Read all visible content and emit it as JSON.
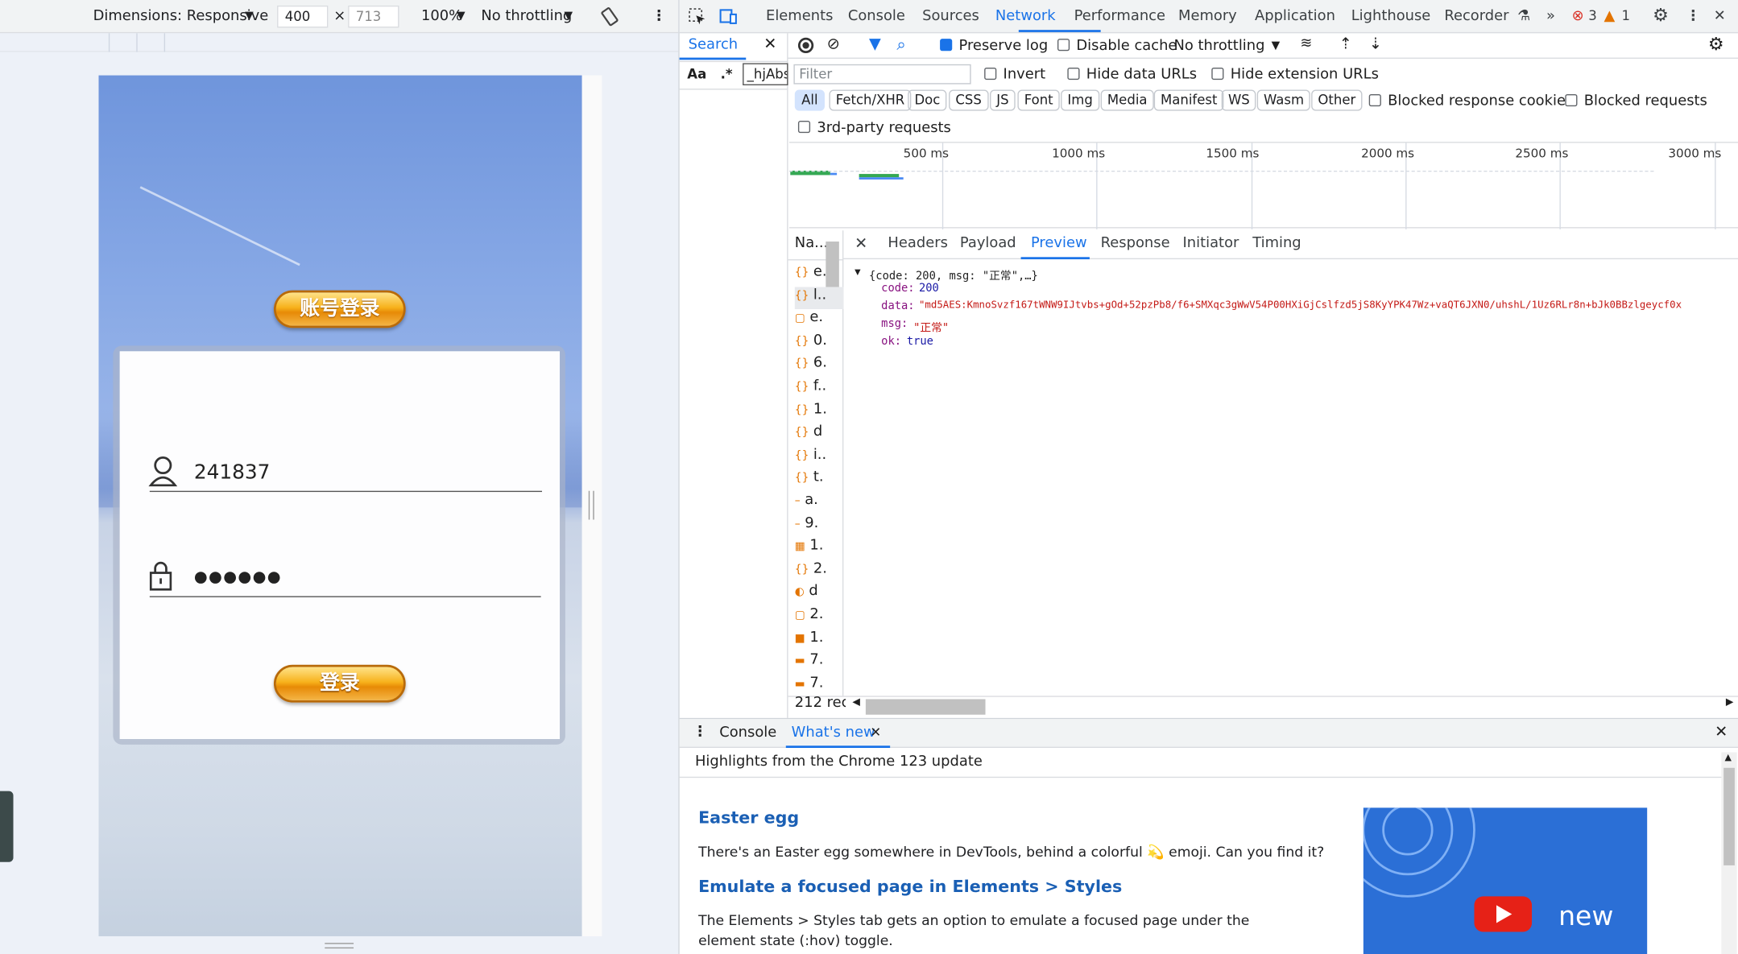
{
  "device_toolbar": {
    "dimensions_label": "Dimensions: Responsive",
    "width": "400",
    "height": "713",
    "zoom": "100%",
    "throttling": "No throttling"
  },
  "login": {
    "tab_title": "账号登录",
    "username": "241837",
    "password_mask": "●●●●●●",
    "login_button": "登录"
  },
  "devtools": {
    "tabs": [
      "Elements",
      "Console",
      "Sources",
      "Network",
      "Performance",
      "Memory",
      "Application",
      "Lighthouse",
      "Recorder"
    ],
    "more": "»",
    "error_count": "3",
    "warning_count": "1",
    "search": {
      "title": "Search",
      "case_label": "Aa",
      "regex_label": ".*",
      "query": "_hjAbs"
    },
    "network": {
      "preserve_log": "Preserve log",
      "disable_cache": "Disable cache",
      "throttling": "No throttling",
      "filter_placeholder": "Filter",
      "invert": "Invert",
      "hide_data_urls": "Hide data URLs",
      "hide_extension_urls": "Hide extension URLs",
      "types": [
        "All",
        "Fetch/XHR",
        "Doc",
        "CSS",
        "JS",
        "Font",
        "Img",
        "Media",
        "Manifest",
        "WS",
        "Wasm",
        "Other"
      ],
      "blocked_cookies": "Blocked response cookies",
      "blocked_requests": "Blocked requests",
      "third_party": "3rd-party requests",
      "timeline_ticks": [
        "500 ms",
        "1000 ms",
        "1500 ms",
        "2000 ms",
        "2500 ms",
        "3000 ms"
      ],
      "name_header": "Na...",
      "names": [
        "e.",
        "l..",
        "e.",
        "0.",
        "6.",
        "f..",
        "1.",
        "d",
        "i..",
        "t.",
        "a.",
        "9.",
        "1.",
        "2.",
        "d",
        "2.",
        "1.",
        "7.",
        "7."
      ],
      "detail_tabs": [
        "Headers",
        "Payload",
        "Preview",
        "Response",
        "Initiator",
        "Timing"
      ],
      "preview": {
        "summary": "{code: 200, msg: \"正常\",…}",
        "code_key": "code:",
        "code_val": "200",
        "data_key": "data:",
        "data_val": "\"md5AES:KmnoSvzf167tWNW9IJtvbs+gOd+52pzPb8/f6+SMXqc3gWwV54P00HXiGjCslfzd5jS8KyYPK47Wz+vaQT6JXN0/uhshL/1Uz6RLr8n+bJk0BBzlgeycf0x",
        "msg_key": "msg:",
        "msg_val": "\"正常\"",
        "ok_key": "ok:",
        "ok_val": "true"
      },
      "status": "212 rec"
    },
    "drawer": {
      "tabs": [
        "Console",
        "What's new"
      ],
      "highlights": "Highlights from the Chrome 123 update",
      "h1": "Easter egg",
      "p1": "There's an Easter egg somewhere in DevTools, behind a colorful 💫 emoji. Can you find it?",
      "h2": "Emulate a focused page in Elements > Styles",
      "p2": "The Elements > Styles tab gets an option to emulate a focused page under the element state (:hov) toggle.",
      "promo_text": "new"
    }
  }
}
